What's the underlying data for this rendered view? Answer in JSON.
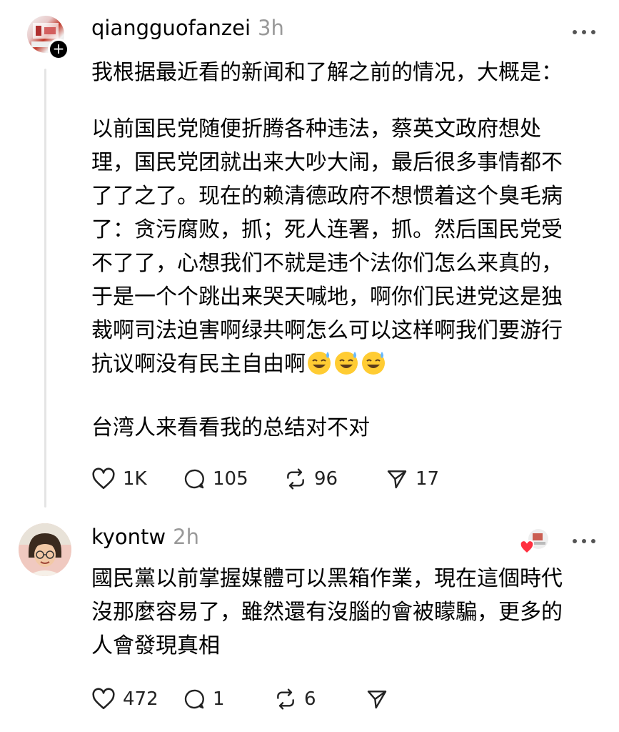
{
  "post1": {
    "username": "qiangguofanzei",
    "time": "3h",
    "more_icon": "more-horizontal-icon",
    "paragraph1": "我根据最近看的新闻和了解之前的情况，大概是：",
    "paragraph2": "以前国民党随便折腾各种违法，蔡英文政府想处\n理，国民党团就出来大吵大闹，最后很多事情都不\n了了之了。现在的赖清德政府不想惯着这个臭毛病\n了：贪污腐败，抓；死人连署，抓。然后国民党受\n不了了，心想我们不就是违个法你们怎么来真的，\n于是一个个跳出来哭天喊地，啊你们民进党这是独\n裁啊司法迫害啊绿共啊怎么可以这样啊我们要游行\n抗议啊没有民主自由啊",
    "emoji_count_label": "😅😅😅",
    "paragraph3": "台湾人来看看我的总结对不对",
    "actions": {
      "like": "1K",
      "reply": "105",
      "repost": "96",
      "share": "17"
    }
  },
  "post2": {
    "username": "kyontw",
    "time": "2h",
    "content": "國民黨以前掌握媒體可以黑箱作業，現在這個時代\n沒那麼容易了，雖然還有沒腦的會被矇騙，更多的\n人會發現真相",
    "actions": {
      "like": "472",
      "reply": "1",
      "repost": "6",
      "share": ""
    }
  },
  "colors": {
    "text": "#000000",
    "muted": "#999999",
    "thread_line": "#e5e5e5",
    "liked_heart": "#ff3040"
  }
}
